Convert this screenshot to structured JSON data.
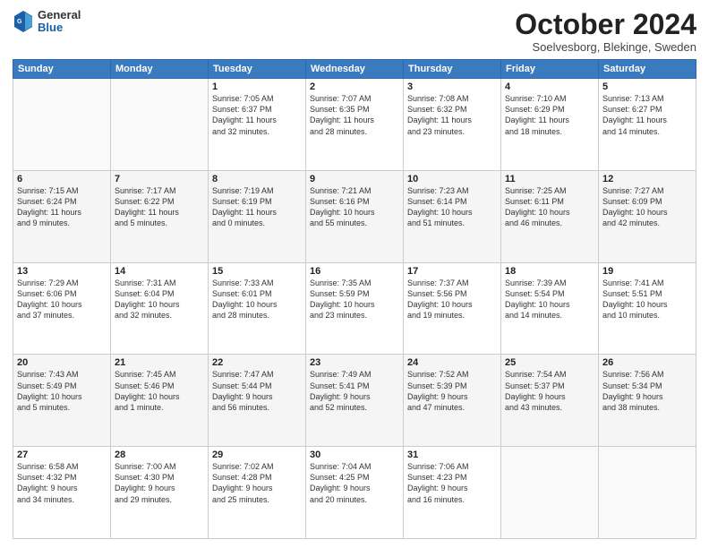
{
  "logo": {
    "general": "General",
    "blue": "Blue"
  },
  "header": {
    "month": "October 2024",
    "location": "Soelvesborg, Blekinge, Sweden"
  },
  "days_of_week": [
    "Sunday",
    "Monday",
    "Tuesday",
    "Wednesday",
    "Thursday",
    "Friday",
    "Saturday"
  ],
  "weeks": [
    [
      {
        "day": "",
        "info": ""
      },
      {
        "day": "",
        "info": ""
      },
      {
        "day": "1",
        "info": "Sunrise: 7:05 AM\nSunset: 6:37 PM\nDaylight: 11 hours\nand 32 minutes."
      },
      {
        "day": "2",
        "info": "Sunrise: 7:07 AM\nSunset: 6:35 PM\nDaylight: 11 hours\nand 28 minutes."
      },
      {
        "day": "3",
        "info": "Sunrise: 7:08 AM\nSunset: 6:32 PM\nDaylight: 11 hours\nand 23 minutes."
      },
      {
        "day": "4",
        "info": "Sunrise: 7:10 AM\nSunset: 6:29 PM\nDaylight: 11 hours\nand 18 minutes."
      },
      {
        "day": "5",
        "info": "Sunrise: 7:13 AM\nSunset: 6:27 PM\nDaylight: 11 hours\nand 14 minutes."
      }
    ],
    [
      {
        "day": "6",
        "info": "Sunrise: 7:15 AM\nSunset: 6:24 PM\nDaylight: 11 hours\nand 9 minutes."
      },
      {
        "day": "7",
        "info": "Sunrise: 7:17 AM\nSunset: 6:22 PM\nDaylight: 11 hours\nand 5 minutes."
      },
      {
        "day": "8",
        "info": "Sunrise: 7:19 AM\nSunset: 6:19 PM\nDaylight: 11 hours\nand 0 minutes."
      },
      {
        "day": "9",
        "info": "Sunrise: 7:21 AM\nSunset: 6:16 PM\nDaylight: 10 hours\nand 55 minutes."
      },
      {
        "day": "10",
        "info": "Sunrise: 7:23 AM\nSunset: 6:14 PM\nDaylight: 10 hours\nand 51 minutes."
      },
      {
        "day": "11",
        "info": "Sunrise: 7:25 AM\nSunset: 6:11 PM\nDaylight: 10 hours\nand 46 minutes."
      },
      {
        "day": "12",
        "info": "Sunrise: 7:27 AM\nSunset: 6:09 PM\nDaylight: 10 hours\nand 42 minutes."
      }
    ],
    [
      {
        "day": "13",
        "info": "Sunrise: 7:29 AM\nSunset: 6:06 PM\nDaylight: 10 hours\nand 37 minutes."
      },
      {
        "day": "14",
        "info": "Sunrise: 7:31 AM\nSunset: 6:04 PM\nDaylight: 10 hours\nand 32 minutes."
      },
      {
        "day": "15",
        "info": "Sunrise: 7:33 AM\nSunset: 6:01 PM\nDaylight: 10 hours\nand 28 minutes."
      },
      {
        "day": "16",
        "info": "Sunrise: 7:35 AM\nSunset: 5:59 PM\nDaylight: 10 hours\nand 23 minutes."
      },
      {
        "day": "17",
        "info": "Sunrise: 7:37 AM\nSunset: 5:56 PM\nDaylight: 10 hours\nand 19 minutes."
      },
      {
        "day": "18",
        "info": "Sunrise: 7:39 AM\nSunset: 5:54 PM\nDaylight: 10 hours\nand 14 minutes."
      },
      {
        "day": "19",
        "info": "Sunrise: 7:41 AM\nSunset: 5:51 PM\nDaylight: 10 hours\nand 10 minutes."
      }
    ],
    [
      {
        "day": "20",
        "info": "Sunrise: 7:43 AM\nSunset: 5:49 PM\nDaylight: 10 hours\nand 5 minutes."
      },
      {
        "day": "21",
        "info": "Sunrise: 7:45 AM\nSunset: 5:46 PM\nDaylight: 10 hours\nand 1 minute."
      },
      {
        "day": "22",
        "info": "Sunrise: 7:47 AM\nSunset: 5:44 PM\nDaylight: 9 hours\nand 56 minutes."
      },
      {
        "day": "23",
        "info": "Sunrise: 7:49 AM\nSunset: 5:41 PM\nDaylight: 9 hours\nand 52 minutes."
      },
      {
        "day": "24",
        "info": "Sunrise: 7:52 AM\nSunset: 5:39 PM\nDaylight: 9 hours\nand 47 minutes."
      },
      {
        "day": "25",
        "info": "Sunrise: 7:54 AM\nSunset: 5:37 PM\nDaylight: 9 hours\nand 43 minutes."
      },
      {
        "day": "26",
        "info": "Sunrise: 7:56 AM\nSunset: 5:34 PM\nDaylight: 9 hours\nand 38 minutes."
      }
    ],
    [
      {
        "day": "27",
        "info": "Sunrise: 6:58 AM\nSunset: 4:32 PM\nDaylight: 9 hours\nand 34 minutes."
      },
      {
        "day": "28",
        "info": "Sunrise: 7:00 AM\nSunset: 4:30 PM\nDaylight: 9 hours\nand 29 minutes."
      },
      {
        "day": "29",
        "info": "Sunrise: 7:02 AM\nSunset: 4:28 PM\nDaylight: 9 hours\nand 25 minutes."
      },
      {
        "day": "30",
        "info": "Sunrise: 7:04 AM\nSunset: 4:25 PM\nDaylight: 9 hours\nand 20 minutes."
      },
      {
        "day": "31",
        "info": "Sunrise: 7:06 AM\nSunset: 4:23 PM\nDaylight: 9 hours\nand 16 minutes."
      },
      {
        "day": "",
        "info": ""
      },
      {
        "day": "",
        "info": ""
      }
    ]
  ]
}
